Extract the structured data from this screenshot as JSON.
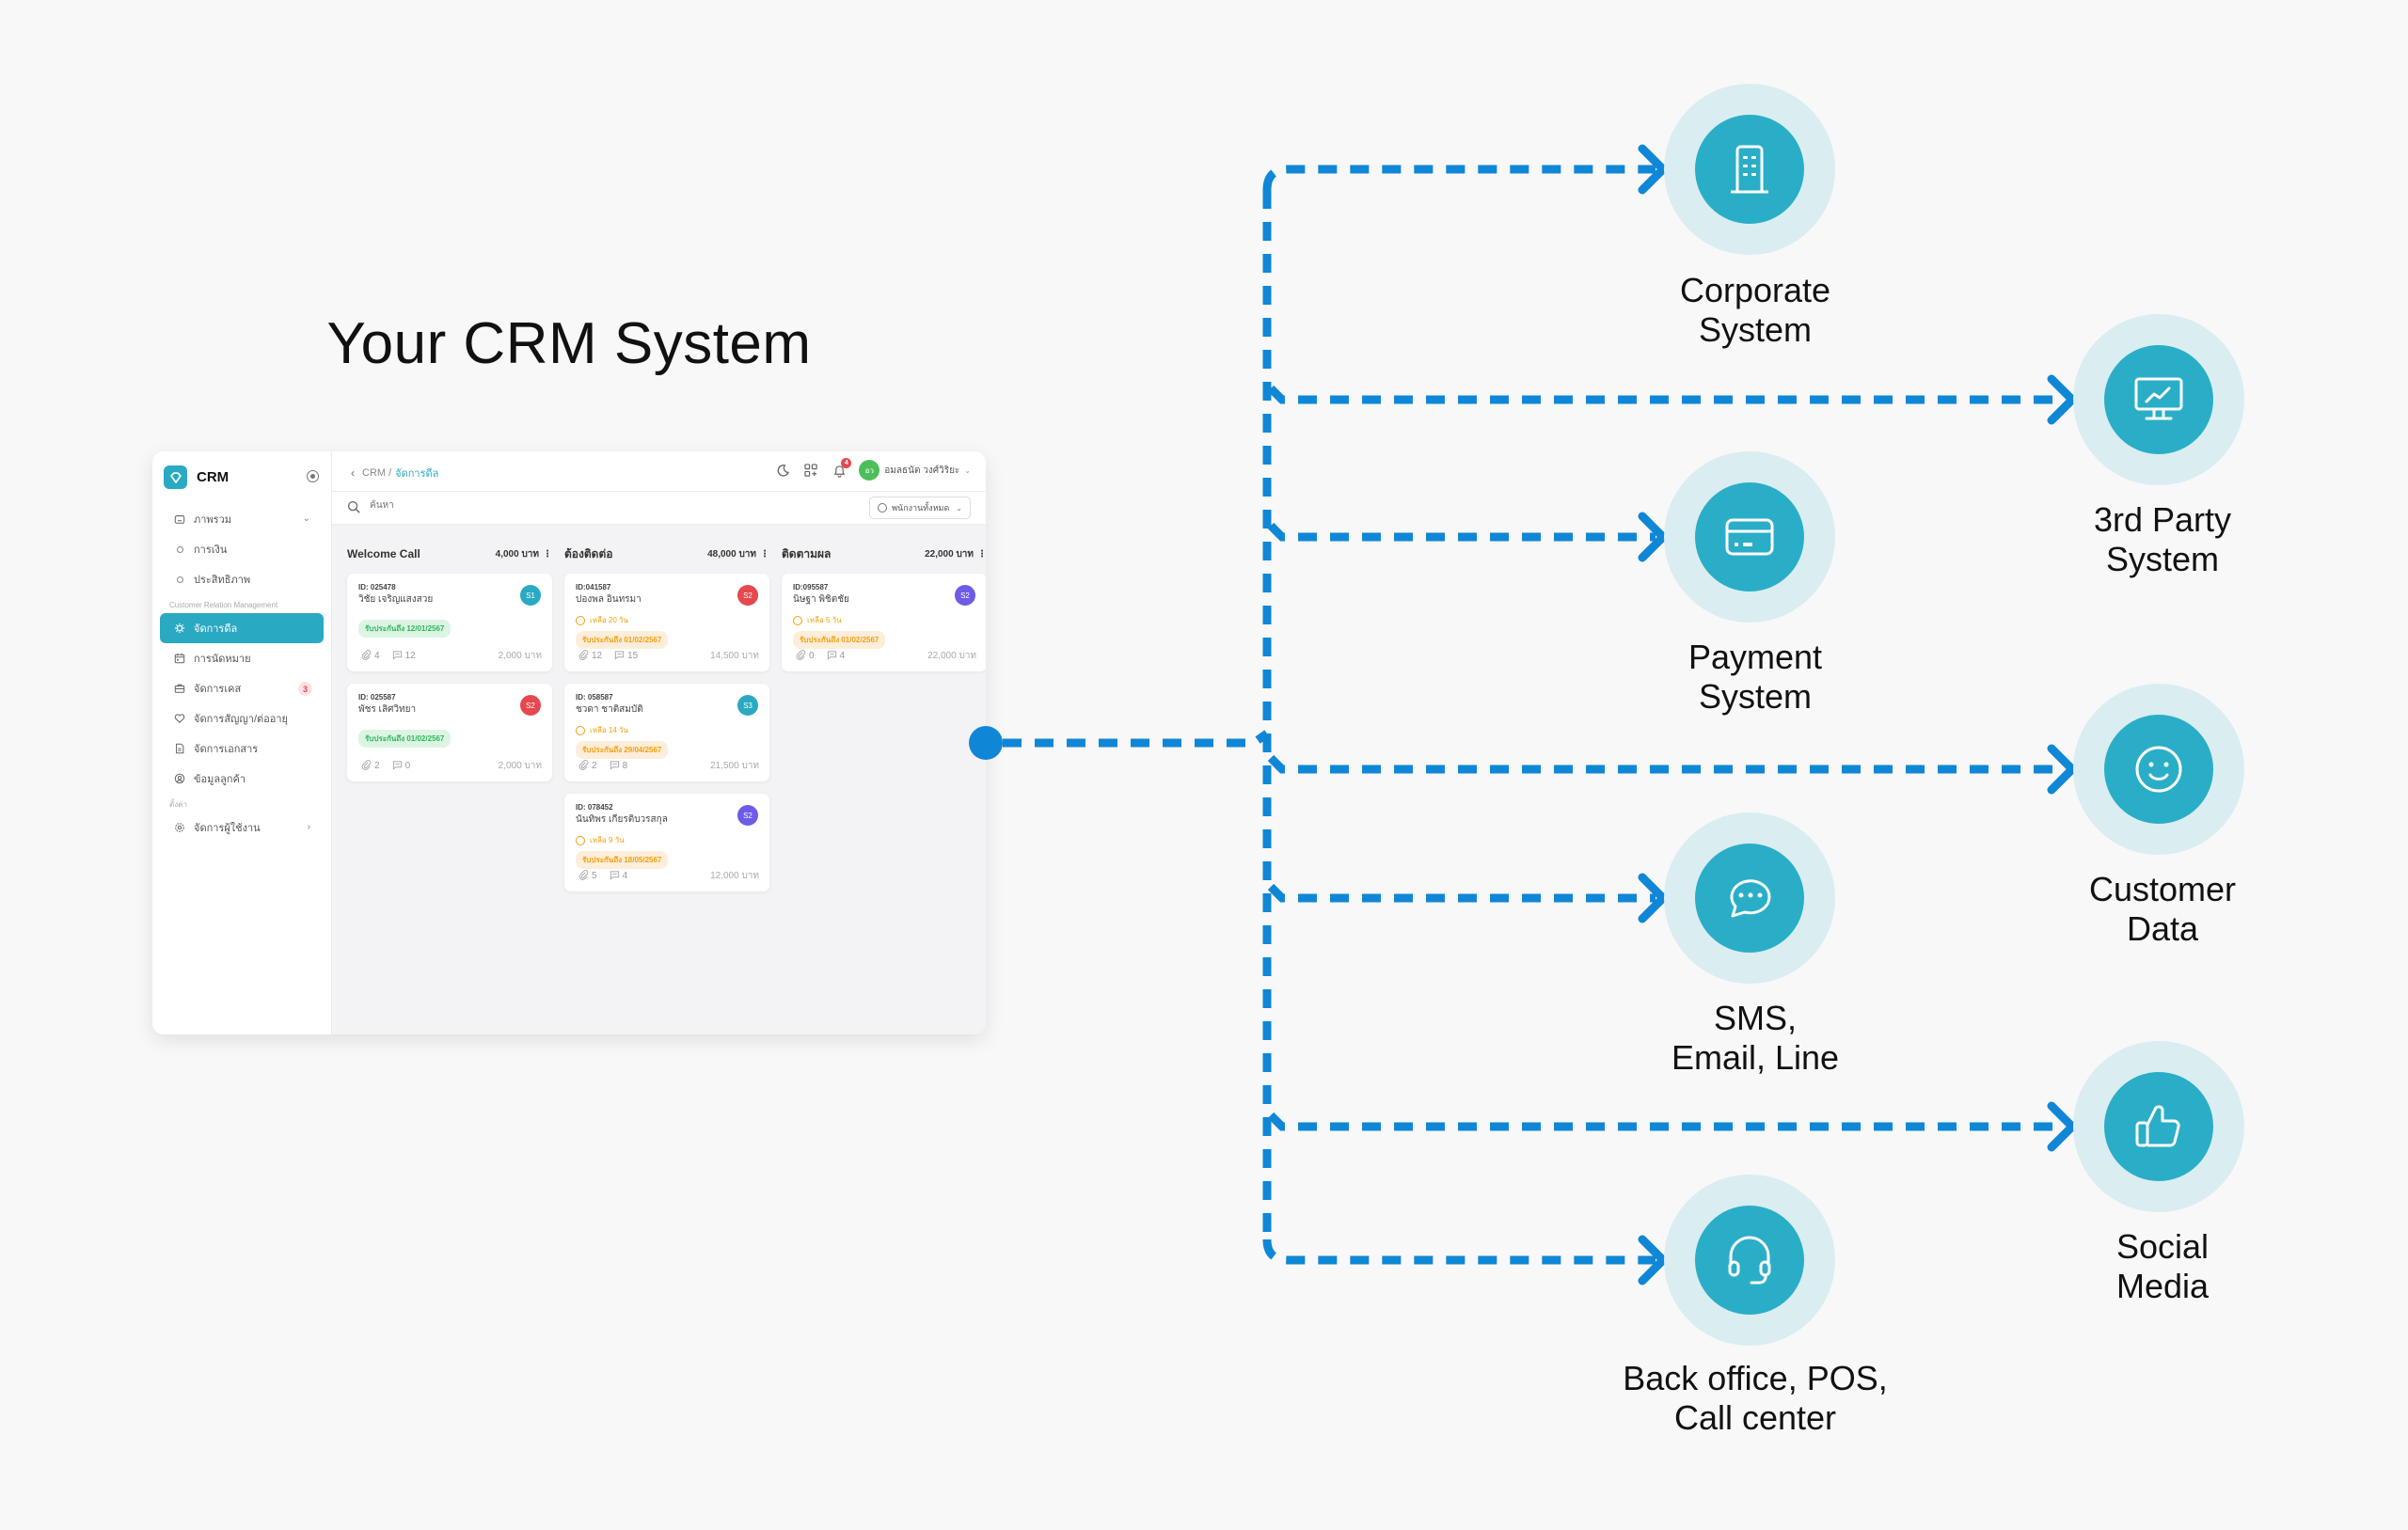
{
  "title": "Your CRM System",
  "colors": {
    "accent": "#2aa9c3",
    "connector": "#0f87d6",
    "node_outer": "#daedf1",
    "node_inner": "#2aaec7",
    "background": "#f8f8f8"
  },
  "crm_window": {
    "brand": {
      "name": "CRM",
      "logo_icon": "crm-logo-icon",
      "pin_icon": "pin-icon"
    },
    "sidebar": {
      "items": [
        {
          "label": "ภาพรวม",
          "icon": "home-icon",
          "expandable": true
        },
        {
          "label": "การเงิน",
          "sub": true
        },
        {
          "label": "ประสิทธิภาพ",
          "sub": true
        },
        {
          "section": "Customer Relation Management"
        },
        {
          "label": "จัดการดีล",
          "icon": "deal-icon",
          "active": true
        },
        {
          "label": "การนัดหมาย",
          "icon": "calendar-icon"
        },
        {
          "label": "จัดการเคส",
          "icon": "briefcase-icon",
          "badge": "3"
        },
        {
          "label": "จัดการสัญญา/ต่ออายุ",
          "icon": "heart-icon"
        },
        {
          "label": "จัดการเอกสาร",
          "icon": "document-icon"
        },
        {
          "label": "ข้อมูลลูกค้า",
          "icon": "user-circle-icon"
        },
        {
          "section": "ตั้งค่า"
        },
        {
          "label": "จัดการผู้ใช้งาน",
          "icon": "gear-icon",
          "chevron": true
        }
      ]
    },
    "topbar": {
      "breadcrumb_root": "CRM /",
      "breadcrumb_current": "จัดการดีล",
      "notification_count": "4",
      "user_initials": "อว",
      "user_name": "อมลธนัต วงศ์วิริยะ"
    },
    "search": {
      "placeholder": "ค้นหา"
    },
    "filter": {
      "label": "พนักงานทั้งหมด"
    },
    "columns": [
      {
        "title": "Welcome Call",
        "total": "4,000 บาท",
        "cards": [
          {
            "id": "ID: 025478",
            "name": "วิชัย เจริญแสงสวย",
            "avatar": "S1",
            "avatar_color": "#2aa9c3",
            "due": "",
            "tag": "รับประกันถึง 12/01/2567",
            "tag_style": "green",
            "attachments": "4",
            "comments": "12",
            "amount": "2,000 บาท"
          },
          {
            "id": "ID: 025587",
            "name": "พัชร เลิศวิทยา",
            "avatar": "S2",
            "avatar_color": "#e5484d",
            "due": "",
            "tag": "รับประกันถึง 01/02/2567",
            "tag_style": "green",
            "attachments": "2",
            "comments": "0",
            "amount": "2,000 บาท"
          }
        ]
      },
      {
        "title": "ต้องติดต่อ",
        "total": "48,000 บาท",
        "cards": [
          {
            "id": "ID:041587",
            "name": "ปองพล อินทรมา",
            "avatar": "S2",
            "avatar_color": "#e5484d",
            "due": "เหลือ 20 วัน",
            "tag": "รับประกันถึง 01/02/2567",
            "tag_style": "orange",
            "attachments": "12",
            "comments": "15",
            "amount": "14,500 บาท"
          },
          {
            "id": "ID: 058587",
            "name": "ชวดา ชาติสมบัติ",
            "avatar": "S3",
            "avatar_color": "#2aa9c3",
            "due": "เหลือ 14 วัน",
            "tag": "รับประกันถึง 29/04/2567",
            "tag_style": "orange",
            "attachments": "2",
            "comments": "8",
            "amount": "21,500 บาท"
          },
          {
            "id": "ID: 078452",
            "name": "นันทิพร เกียรติบวรสกุล",
            "avatar": "S2",
            "avatar_color": "#6c5ce7",
            "due": "เหลือ 9 วัน",
            "tag": "รับประกันถึง 18/05/2567",
            "tag_style": "orange",
            "attachments": "5",
            "comments": "4",
            "amount": "12,000 บาท"
          }
        ]
      },
      {
        "title": "ติดตามผล",
        "total": "22,000 บาท",
        "cards": [
          {
            "id": "ID:095587",
            "name": "นิษฐา พิชิตชัย",
            "avatar": "S2",
            "avatar_color": "#6c5ce7",
            "due": "เหลือ 5 วัน",
            "tag": "รับประกันถึง 01/02/2567",
            "tag_style": "orange",
            "attachments": "0",
            "comments": "4",
            "amount": "22,000 บาท"
          }
        ]
      }
    ]
  },
  "integrations": [
    {
      "label": "Corporate\nSystem",
      "icon": "building-icon",
      "side": "left"
    },
    {
      "label": "3rd Party\nSystem",
      "icon": "monitor-chart-icon",
      "side": "right"
    },
    {
      "label": "Payment\nSystem",
      "icon": "credit-card-icon",
      "side": "left"
    },
    {
      "label": "Customer\nData",
      "icon": "smiley-icon",
      "side": "right"
    },
    {
      "label": "SMS,\nEmail, Line",
      "icon": "chat-bubble-icon",
      "side": "left"
    },
    {
      "label": "Social\nMedia",
      "icon": "thumbs-up-icon",
      "side": "right"
    },
    {
      "label": "Back office, POS,\nCall center",
      "icon": "headset-icon",
      "side": "left"
    }
  ]
}
